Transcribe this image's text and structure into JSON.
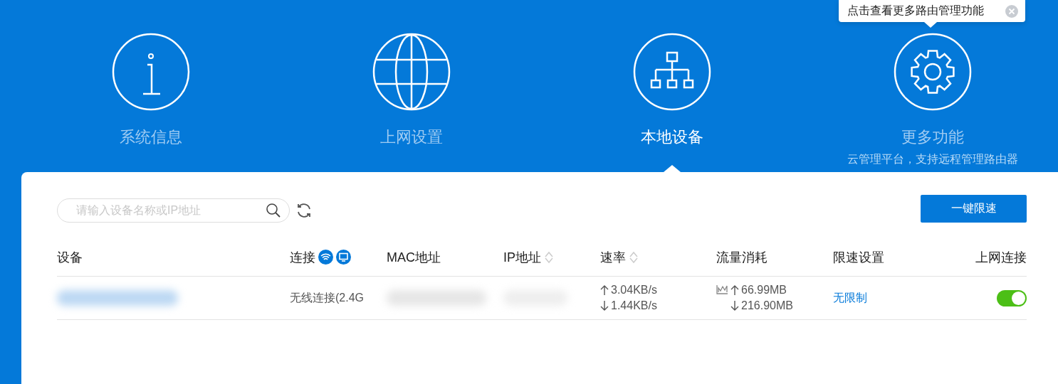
{
  "nav": {
    "items": [
      {
        "kind": "info",
        "label": "系统信息",
        "selected": false
      },
      {
        "kind": "globe",
        "label": "上网设置",
        "selected": false
      },
      {
        "kind": "network",
        "label": "本地设备",
        "selected": true
      },
      {
        "kind": "gear",
        "label": "更多功能",
        "sublabel": "云管理平台，支持远程管理路由器",
        "selected": false
      }
    ]
  },
  "tooltip": {
    "text": "点击查看更多路由管理功能"
  },
  "toolbar": {
    "search": {
      "placeholder": "请输入设备名称或IP地址"
    },
    "button": "一键限速"
  },
  "table": {
    "columns": [
      {
        "kind": "plain",
        "label": "设备"
      },
      {
        "kind": "connection",
        "label": "连接"
      },
      {
        "kind": "plain",
        "label": "MAC地址"
      },
      {
        "kind": "sortable",
        "label": "IP地址"
      },
      {
        "kind": "sortable",
        "label": "速率"
      },
      {
        "kind": "plain",
        "label": "流量消耗"
      },
      {
        "kind": "plain",
        "label": "限速设置"
      },
      {
        "kind": "plain",
        "label": "上网连接"
      }
    ],
    "rows": [
      {
        "connection": "无线连接(2.4G",
        "speed_up": "3.04KB/s",
        "speed_down": "1.44KB/s",
        "traffic_up": "66.99MB",
        "traffic_down": "216.90MB",
        "limit": "无限制",
        "online": true
      }
    ]
  }
}
